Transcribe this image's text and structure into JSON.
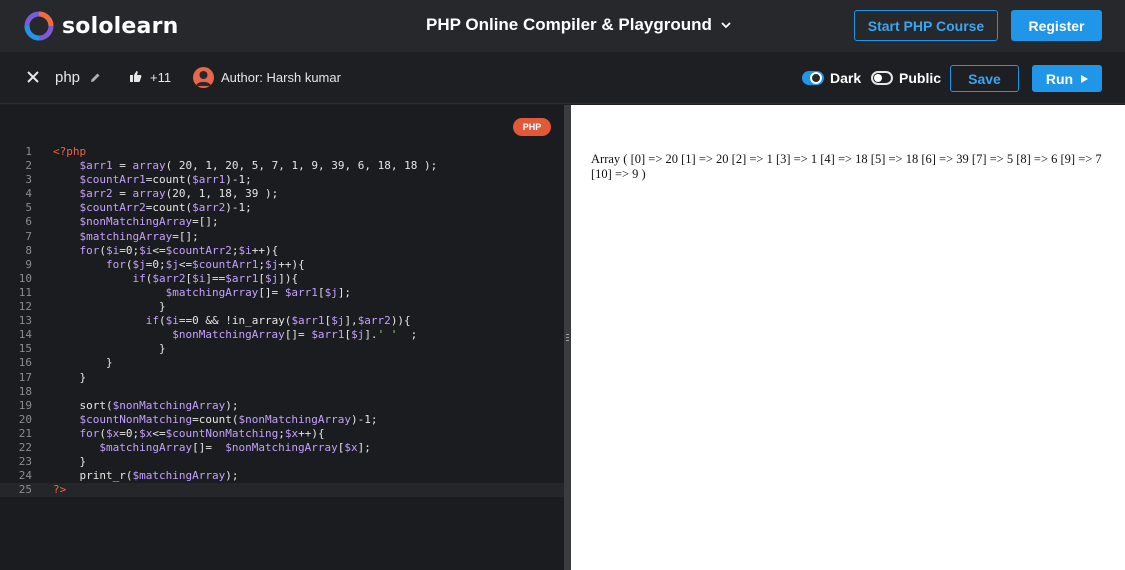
{
  "brand": {
    "name": "sololearn",
    "colors": {
      "orange": "#f26b3a",
      "purple": "#7b5bd6",
      "blue": "#1f96e8"
    }
  },
  "topnav": {
    "title": "PHP Online Compiler & Playground",
    "start_course_label": "Start PHP Course",
    "register_label": "Register"
  },
  "toolbar": {
    "language": "php",
    "likes": "+11",
    "author": "Author: Harsh kumar",
    "dark_label": "Dark",
    "public_label": "Public",
    "save_label": "Save",
    "run_label": "Run"
  },
  "editor": {
    "badge": "PHP",
    "active_line": 25,
    "lines": [
      {
        "n": "1",
        "t": "<?php"
      },
      {
        "n": "2",
        "t": "    $arr1 = array( 20, 1, 20, 5, 7, 1, 9, 39, 6, 18, 18 );"
      },
      {
        "n": "3",
        "t": "    $countArr1=count($arr1)-1;"
      },
      {
        "n": "4",
        "t": "    $arr2 = array(20, 1, 18, 39 );"
      },
      {
        "n": "5",
        "t": "    $countArr2=count($arr2)-1;"
      },
      {
        "n": "6",
        "t": "    $nonMatchingArray=[];"
      },
      {
        "n": "7",
        "t": "    $matchingArray=[];"
      },
      {
        "n": "8",
        "t": "    for($i=0;$i<=$countArr2;$i++){"
      },
      {
        "n": "9",
        "t": "        for($j=0;$j<=$countArr1;$j++){"
      },
      {
        "n": "10",
        "t": "            if($arr2[$i]==$arr1[$j]){"
      },
      {
        "n": "11",
        "t": "                 $matchingArray[]= $arr1[$j];"
      },
      {
        "n": "12",
        "t": "                }"
      },
      {
        "n": "13",
        "t": "              if($i==0 && !in_array($arr1[$j],$arr2)){"
      },
      {
        "n": "14",
        "t": "                  $nonMatchingArray[]= $arr1[$j].' '  ;"
      },
      {
        "n": "15",
        "t": "                }"
      },
      {
        "n": "16",
        "t": "        }"
      },
      {
        "n": "17",
        "t": "    }"
      },
      {
        "n": "18",
        "t": ""
      },
      {
        "n": "19",
        "t": "    sort($nonMatchingArray);"
      },
      {
        "n": "20",
        "t": "    $countNonMatching=count($nonMatchingArray)-1;"
      },
      {
        "n": "21",
        "t": "    for($x=0;$x<=$countNonMatching;$x++){"
      },
      {
        "n": "22",
        "t": "       $matchingArray[]=  $nonMatchingArray[$x];"
      },
      {
        "n": "23",
        "t": "    }"
      },
      {
        "n": "24",
        "t": "    print_r($matchingArray);"
      },
      {
        "n": "25",
        "t": "?>"
      }
    ]
  },
  "output": {
    "text": "Array ( [0] => 20 [1] => 20 [2] => 1 [3] => 1 [4] => 18 [5] => 18 [6] => 39 [7] => 5 [8] => 6 [9] => 7 [10] => 9 )"
  },
  "icons": [
    "sololearn-logo-icon",
    "chevron-down-icon",
    "close-icon",
    "pencil-icon",
    "thumbs-up-icon",
    "avatar-icon",
    "play-icon",
    "splitter-grip-icon"
  ]
}
